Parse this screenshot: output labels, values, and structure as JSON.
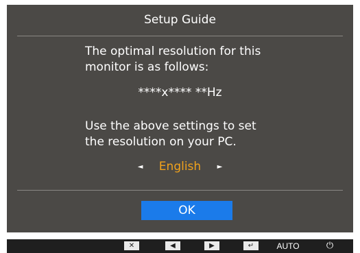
{
  "osd": {
    "title": "Setup Guide",
    "message_line1": "The optimal resolution for this",
    "message_line2": "monitor is as follows:",
    "resolution": "****x**** **Hz",
    "instruction_line1": "Use the above settings to set",
    "instruction_line2": "the resolution on your PC.",
    "language": "English",
    "left_arrow": "◄",
    "right_arrow": "►",
    "ok_label": "OK"
  },
  "keybar": {
    "close_glyph": "✕",
    "left_glyph": "◀",
    "right_glyph": "▶",
    "enter_glyph": "↵",
    "auto_label": "AUTO",
    "power_glyph": "⏻"
  },
  "colors": {
    "panel_bg": "#4b4946",
    "accent_language": "#f0a21c",
    "ok_button": "#1b7bea",
    "keybar_bg": "#1f1f1f"
  }
}
